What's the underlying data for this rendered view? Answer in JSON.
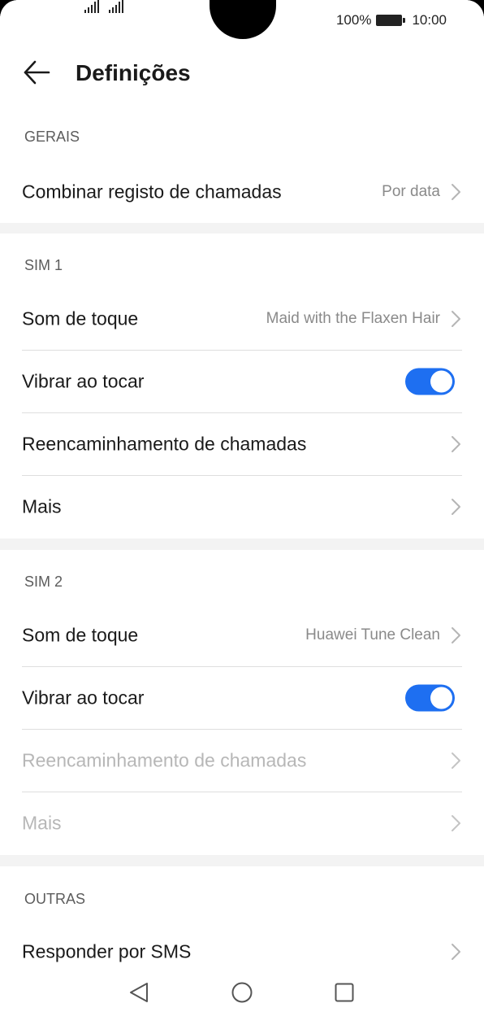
{
  "status_bar": {
    "battery_percent": "100%",
    "time": "10:00"
  },
  "header": {
    "title": "Definições",
    "back_icon": "arrow-left-icon"
  },
  "sections": {
    "general": {
      "label": "GERAIS",
      "combine_log": {
        "label": "Combinar registo de chamadas",
        "value": "Por data"
      }
    },
    "sim1": {
      "label": "SIM 1",
      "ringtone": {
        "label": "Som de toque",
        "value": "Maid with the Flaxen Hair"
      },
      "vibrate": {
        "label": "Vibrar ao tocar",
        "enabled": true
      },
      "forwarding": {
        "label": "Reencaminhamento de chamadas"
      },
      "more": {
        "label": "Mais"
      }
    },
    "sim2": {
      "label": "SIM 2",
      "ringtone": {
        "label": "Som de toque",
        "value": "Huawei Tune Clean"
      },
      "vibrate": {
        "label": "Vibrar ao tocar",
        "enabled": true
      },
      "forwarding": {
        "label": "Reencaminhamento de chamadas",
        "disabled": true
      },
      "more": {
        "label": "Mais",
        "disabled": true
      }
    },
    "other": {
      "label": "OUTRAS",
      "sms_reply": {
        "label": "Responder por SMS"
      }
    }
  },
  "nav_bar": {
    "back": "triangle-back-icon",
    "home": "circle-home-icon",
    "recents": "square-recents-icon"
  },
  "colors": {
    "accent": "#1e6ff1",
    "background": "#f3f3f3",
    "surface": "#ffffff",
    "disabled_text": "#b7b7b7"
  }
}
